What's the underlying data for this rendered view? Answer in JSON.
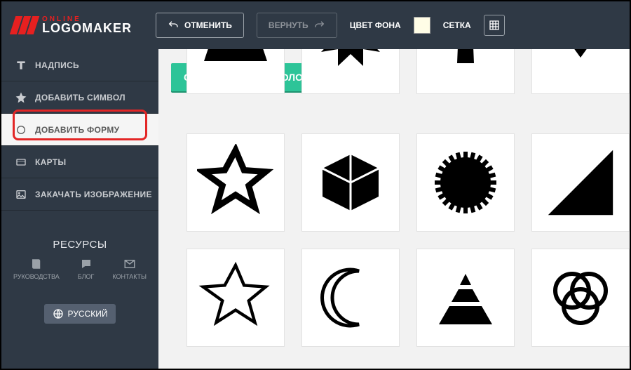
{
  "logo": {
    "line1": "ONLINE",
    "line2": "LOGOMAKER"
  },
  "topbar": {
    "undo": "ОТМЕНИТЬ",
    "redo": "ВЕРНУТЬ",
    "bg_color_label": "ЦВЕТ ФОНА",
    "grid_label": "СЕТКА"
  },
  "sidebar": {
    "items": [
      {
        "label": "НАДПИСЬ",
        "icon": "text-icon"
      },
      {
        "label": "ДОБАВИТЬ СИМВОЛ",
        "icon": "star-icon"
      },
      {
        "label": "ДОБАВИТЬ ФОРМУ",
        "icon": "circle-icon",
        "active": true
      },
      {
        "label": "КАРТЫ",
        "icon": "card-icon"
      },
      {
        "label": "ЗАКАЧАТЬ ИЗОБРАЖЕНИЕ",
        "icon": "image-icon"
      }
    ],
    "resources_heading": "РЕСУРСЫ",
    "resources": [
      {
        "label": "РУКОВОДСТВА",
        "icon": "book-icon"
      },
      {
        "label": "БЛОГ",
        "icon": "comment-icon"
      },
      {
        "label": "КОНТАКТЫ",
        "icon": "mail-icon"
      }
    ],
    "language": "РУССКИЙ"
  },
  "main": {
    "more_symbols": "СМ. БОЛЬШЕ СИМВОЛОВ ...",
    "shapes_partial": [
      "trapezoid",
      "burst",
      "arrow-up",
      "caret-down"
    ],
    "shapes": [
      "star-outline",
      "cube",
      "gear-circle",
      "triangle-right",
      "star-outline-thin",
      "crescent",
      "pyramid",
      "venn"
    ]
  }
}
